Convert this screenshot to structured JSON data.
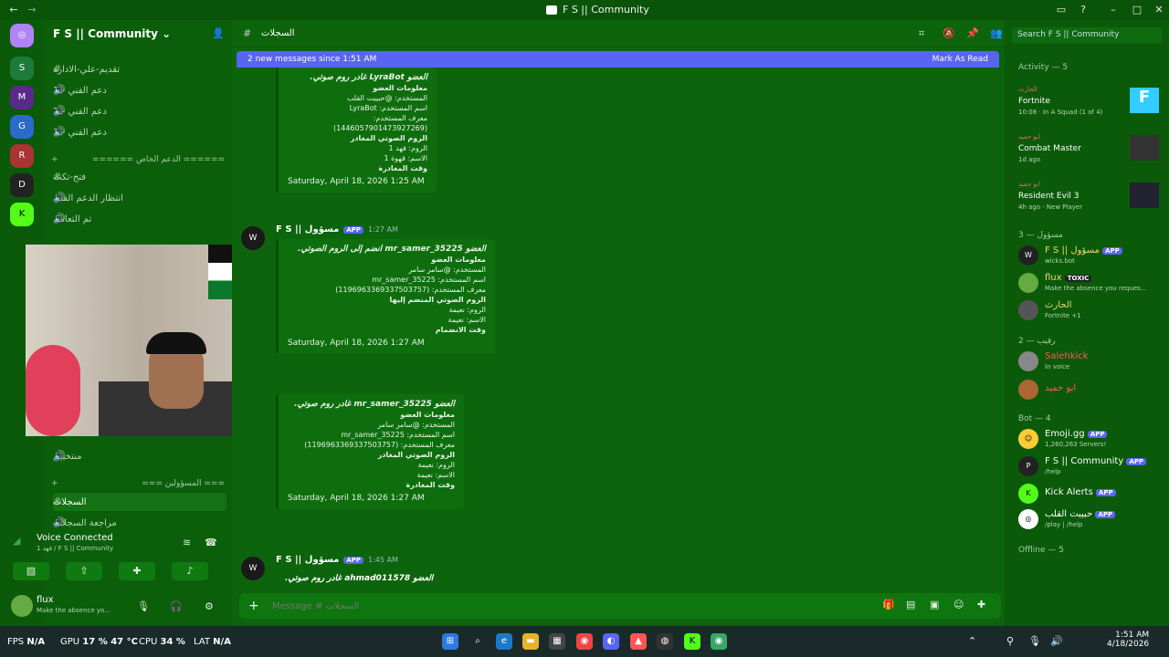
{
  "window": {
    "title": "F S || Community"
  },
  "server": {
    "name": "F S || Community"
  },
  "channels": [
    {
      "label": "تقديم-علي-الادارة",
      "sym": "#"
    },
    {
      "label": "دعم الفني - 1",
      "sym": "🔊"
    },
    {
      "label": "دعم الفني - 2",
      "sym": "🔊"
    },
    {
      "label": "دعم الفني - 3",
      "sym": "🔊"
    }
  ],
  "category_support": "====== الدعم الخاص ======",
  "channels2": [
    {
      "label": "فتح-تكت",
      "sym": "#"
    },
    {
      "label": "انتظار الدعم الفني",
      "sym": "🔊"
    },
    {
      "label": "تم التعامل",
      "sym": "🔊"
    }
  ],
  "category_officials": "=== المسؤولين ===",
  "channels3": [
    {
      "label": "منتخبين",
      "sym": "🔊"
    },
    {
      "label": "السجلات",
      "sym": "#",
      "selected": true
    },
    {
      "label": "مراجعة السجلات",
      "sym": "🔊"
    }
  ],
  "voice": {
    "status": "Voice Connected",
    "detail": "فهد 1 / F S || Community"
  },
  "user": {
    "name": "flux",
    "status": "Make the absence yo..."
  },
  "header": {
    "channel": "السجلات",
    "search_placeholder": "Search F S || Community"
  },
  "newbar": {
    "text": "2 new messages since 1:51 AM",
    "action": "Mark As Read"
  },
  "messages": [
    {
      "embed_title": "العضو LyraBot غادر روم صوتي.",
      "sec1": "معلومات العضو",
      "l1": "المستخدم: @حبيبت القلب",
      "l2": "اسم المستخدم: LyraBot",
      "l3": "معرف المستخدم: (1446057901473927269)",
      "sec2": "الروم الصوتي المغادر",
      "l4": "الروم: فهد 1",
      "l5": "الاسم: قهوة 1",
      "sec3": "وقت المغادرة",
      "time": "Saturday, April 18, 2026 1:25 AM"
    },
    {
      "author": "F S || مسؤول",
      "badge": "APP",
      "stamp": "1:27 AM",
      "embed_title": "العضو mr_samer_35225 انضم إلى الروم الصوتي.",
      "sec1": "معلومات العضو",
      "l1": "المستخدم: @سامر سامر",
      "l2": "اسم المستخدم: mr_samer_35225",
      "l3": "معرف المستخدم: (1196963369337503757)",
      "sec2": "الروم الصوتي المنضم إليها",
      "l4": "الروم: نعيمة",
      "l5": "الاسم: نعيمة",
      "sec3": "وقت الانضمام",
      "time": "Saturday, April 18, 2026 1:27 AM"
    },
    {
      "embed_title": "العضو mr_samer_35225 غادر روم صوتي.",
      "sec1": "معلومات العضو",
      "l1": "المستخدم: @سامر سامر",
      "l2": "اسم المستخدم: mr_samer_35225",
      "l3": "معرف المستخدم: (1196963369337503757)",
      "sec2": "الروم الصوتي المغادر",
      "l4": "الروم: نعيمة",
      "l5": "الاسم: نعيمة",
      "sec3": "وقت المغادرة",
      "time": "Saturday, April 18, 2026 1:27 AM"
    },
    {
      "author": "F S || مسؤول",
      "badge": "APP",
      "stamp": "1:45 AM",
      "embed_title": "العضو ahmad011578 غادر روم صوتي."
    }
  ],
  "composer": {
    "placeholder": "Message # السجلات"
  },
  "members": {
    "activity_label": "Activity — 5",
    "activity": [
      {
        "who": "الحارث",
        "game": "Fortnite",
        "sub": "10:08 · In A Squad (1 of 4)"
      },
      {
        "who": "ابو حميد",
        "game": "Combat Master",
        "sub": "1d ago"
      },
      {
        "who": "ابو حميد",
        "game": "Resident Evil 3",
        "sub": "4h ago · New Player"
      }
    ],
    "g1": "مسؤول — 3",
    "g1_members": [
      {
        "name": "F S || مسؤول",
        "sub": "wicks.bot",
        "badge": "APP"
      },
      {
        "name": "flux",
        "sub": "Make the absence you reques...",
        "badge": "TOXIC"
      },
      {
        "name": "الحارث",
        "sub": "Fortnite +1"
      }
    ],
    "g2": "رقيب — 2",
    "g2_members": [
      {
        "name": "Salehkick",
        "sub": "In voice"
      },
      {
        "name": "ابو حميد",
        "sub": ""
      }
    ],
    "g3": "Bot — 4",
    "g3_members": [
      {
        "name": "Emoji.gg",
        "sub": "1,260,263 Servers!",
        "badge": "APP"
      },
      {
        "name": "F S || Community",
        "sub": "/help",
        "badge": "APP"
      },
      {
        "name": "Kick Alerts",
        "sub": "",
        "badge": "APP"
      },
      {
        "name": "حبيبت القلب",
        "sub": "/play | /help",
        "badge": "APP"
      }
    ],
    "g4": "Offline — 5"
  },
  "taskbar": {
    "fps": "FPS",
    "fps_v": "N/A",
    "gpu": "GPU",
    "gpu_v": "17 % 47 °C",
    "cpu": "CPU",
    "cpu_v": "34 %",
    "lat": "LAT",
    "lat_v": "N/A",
    "time": "1:51 AM",
    "date": "4/18/2026"
  }
}
